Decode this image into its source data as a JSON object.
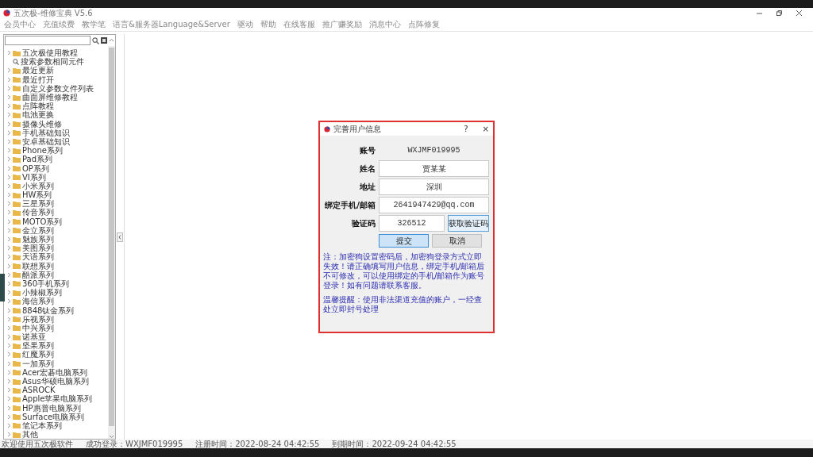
{
  "window": {
    "title": "五次极-维修宝典 V5.6"
  },
  "menu": [
    "会员中心",
    "充值续费",
    "教学笔",
    "语言&服务器Language&Server",
    "驱动",
    "帮助",
    "在线客服",
    "推广赚奖励",
    "消息中心",
    "点阵修复"
  ],
  "sidebar": {
    "items": [
      {
        "label": "五次极使用教程",
        "kind": "folder"
      },
      {
        "label": "搜索参数相同元件",
        "kind": "search"
      },
      {
        "label": "最近更新",
        "kind": "folder"
      },
      {
        "label": "最近打开",
        "kind": "folder"
      },
      {
        "label": "自定义参数文件列表",
        "kind": "folder"
      },
      {
        "label": "曲面屏维修教程",
        "kind": "folder"
      },
      {
        "label": "点阵教程",
        "kind": "folder"
      },
      {
        "label": "电池更换",
        "kind": "folder"
      },
      {
        "label": "摄像头维修",
        "kind": "folder"
      },
      {
        "label": "手机基础知识",
        "kind": "folder"
      },
      {
        "label": "安卓基础知识",
        "kind": "folder"
      },
      {
        "label": "Phone系列",
        "kind": "folder"
      },
      {
        "label": "Pad系列",
        "kind": "folder"
      },
      {
        "label": "OP系列",
        "kind": "folder"
      },
      {
        "label": "VI系列",
        "kind": "folder"
      },
      {
        "label": "小米系列",
        "kind": "folder"
      },
      {
        "label": "HW系列",
        "kind": "folder"
      },
      {
        "label": "三星系列",
        "kind": "folder"
      },
      {
        "label": "传音系列",
        "kind": "folder"
      },
      {
        "label": "MOTO系列",
        "kind": "folder"
      },
      {
        "label": "金立系列",
        "kind": "folder"
      },
      {
        "label": "魅族系列",
        "kind": "folder"
      },
      {
        "label": "美图系列",
        "kind": "folder"
      },
      {
        "label": "天语系列",
        "kind": "folder"
      },
      {
        "label": "联想系列",
        "kind": "folder"
      },
      {
        "label": "酷派系列",
        "kind": "folder"
      },
      {
        "label": "360手机系列",
        "kind": "folder"
      },
      {
        "label": "小辣椒系列",
        "kind": "folder"
      },
      {
        "label": "海信系列",
        "kind": "folder"
      },
      {
        "label": "8848钛金系列",
        "kind": "folder"
      },
      {
        "label": "乐视系列",
        "kind": "folder"
      },
      {
        "label": "中兴系列",
        "kind": "folder"
      },
      {
        "label": "诺基亚",
        "kind": "folder"
      },
      {
        "label": "坚果系列",
        "kind": "folder"
      },
      {
        "label": "红魔系列",
        "kind": "folder"
      },
      {
        "label": "一加系列",
        "kind": "folder"
      },
      {
        "label": "Acer宏碁电脑系列",
        "kind": "folder"
      },
      {
        "label": "Asus华硕电脑系列",
        "kind": "folder"
      },
      {
        "label": "ASROCK",
        "kind": "folder"
      },
      {
        "label": "Apple苹果电脑系列",
        "kind": "folder"
      },
      {
        "label": "HP惠普电脑系列",
        "kind": "folder"
      },
      {
        "label": "Surface电脑系列",
        "kind": "folder"
      },
      {
        "label": "笔记本系列",
        "kind": "folder"
      },
      {
        "label": "其他",
        "kind": "folder"
      }
    ]
  },
  "dialog": {
    "title": "完善用户信息",
    "help": "?",
    "close": "×",
    "account": {
      "label": "账号",
      "value": "WXJMF019995"
    },
    "fields": [
      {
        "label": "姓名",
        "value": "贾某某"
      },
      {
        "label": "地址",
        "value": "深圳"
      },
      {
        "label": "绑定手机/邮箱",
        "value": "2641947429@qq.com"
      }
    ],
    "code": {
      "label": "验证码",
      "value": "326512",
      "button": "获取验证码"
    },
    "buttons": [
      {
        "label": "提交",
        "selected": true
      },
      {
        "label": "取消",
        "selected": false
      }
    ],
    "notes": [
      "注：加密狗设置密码后，加密狗登录方式立即失效！请正确填写用户信息，绑定手机/邮箱后不可修改，可以使用绑定的手机/邮箱作为账号登录！如有问题请联系客服。",
      "温馨提醒：使用非法渠道充值的账户，一经查处立即封号处理"
    ]
  },
  "status_bar": [
    "欢迎使用五次极软件",
    "成功登录：WXJMF019995",
    "注册时间：2022-08-24 04:42:55",
    "到期时间：2022-09-24 04:42:55"
  ]
}
